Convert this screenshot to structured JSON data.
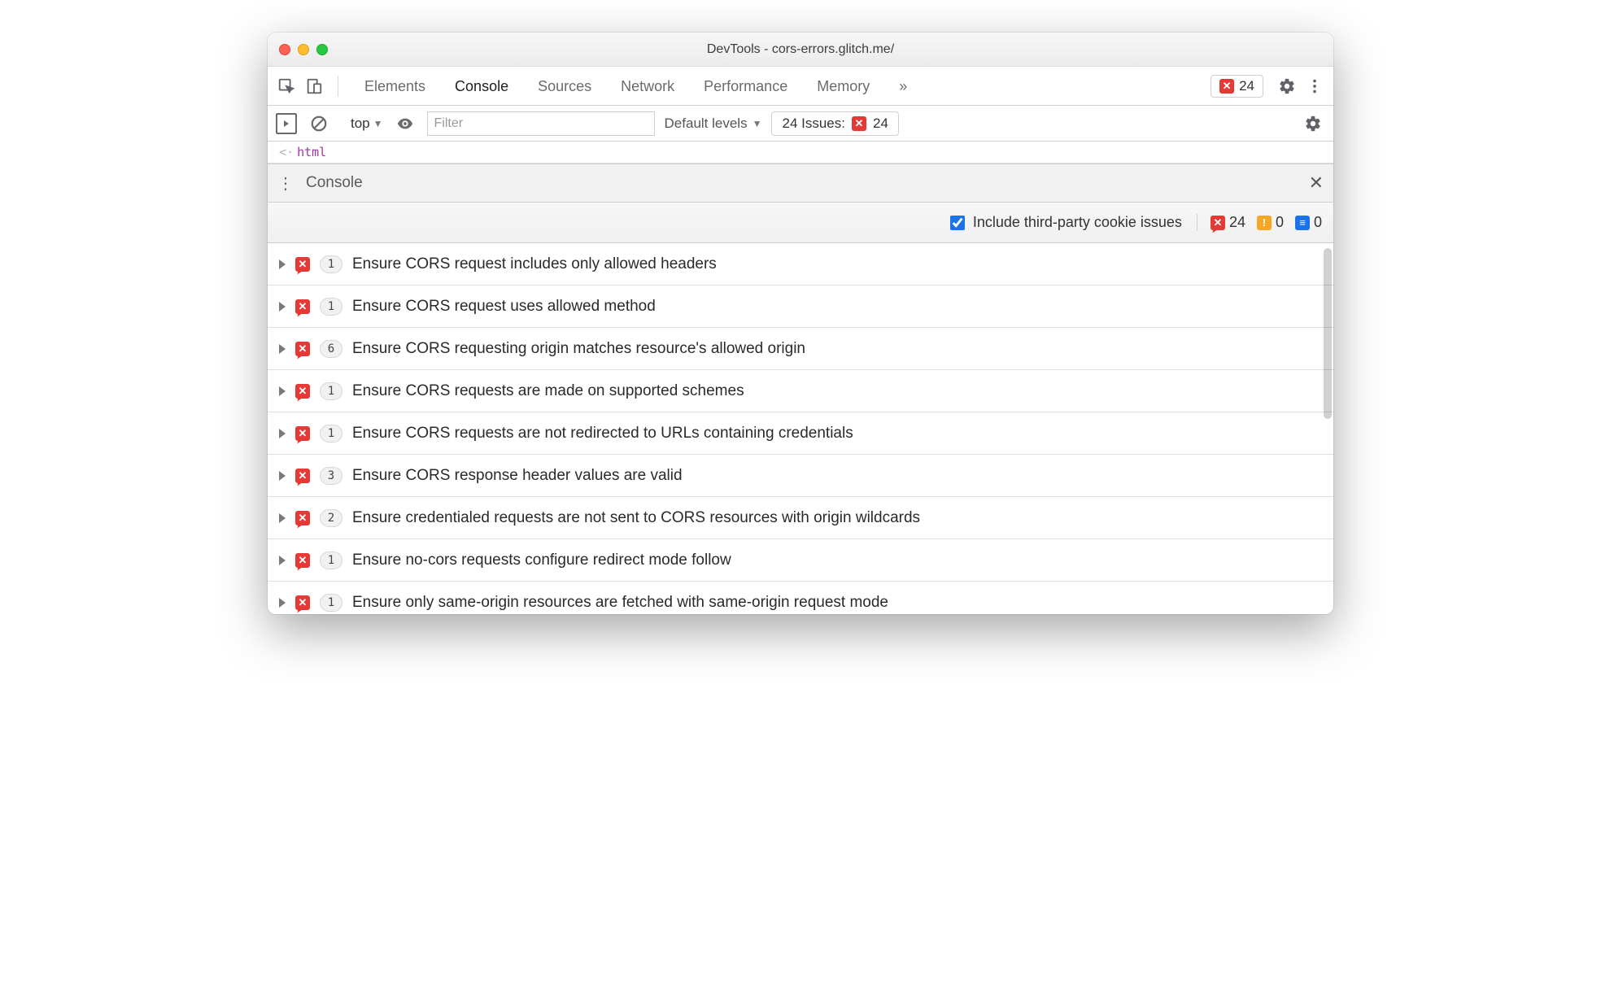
{
  "window": {
    "title": "DevTools - cors-errors.glitch.me/"
  },
  "toolbar": {
    "tabs": [
      "Elements",
      "Console",
      "Sources",
      "Network",
      "Performance",
      "Memory"
    ],
    "active_tab": "Console",
    "overflow_label": "»",
    "error_count": "24"
  },
  "subbar": {
    "context": "top",
    "filter_placeholder": "Filter",
    "levels_label": "Default levels",
    "issues_label": "24 Issues:",
    "issues_count": "24"
  },
  "source_line": {
    "arrow": "<·",
    "text": "html"
  },
  "drawer": {
    "title": "Console"
  },
  "issues_toolbar": {
    "checkbox_label": "Include third-party cookie issues",
    "checked": true,
    "errors": "24",
    "warnings": "0",
    "info": "0"
  },
  "issues": [
    {
      "count": "1",
      "title": "Ensure CORS request includes only allowed headers"
    },
    {
      "count": "1",
      "title": "Ensure CORS request uses allowed method"
    },
    {
      "count": "6",
      "title": "Ensure CORS requesting origin matches resource's allowed origin"
    },
    {
      "count": "1",
      "title": "Ensure CORS requests are made on supported schemes"
    },
    {
      "count": "1",
      "title": "Ensure CORS requests are not redirected to URLs containing credentials"
    },
    {
      "count": "3",
      "title": "Ensure CORS response header values are valid"
    },
    {
      "count": "2",
      "title": "Ensure credentialed requests are not sent to CORS resources with origin wildcards"
    },
    {
      "count": "1",
      "title": "Ensure no-cors requests configure redirect mode follow"
    },
    {
      "count": "1",
      "title": "Ensure only same-origin resources are fetched with same-origin request mode"
    }
  ]
}
